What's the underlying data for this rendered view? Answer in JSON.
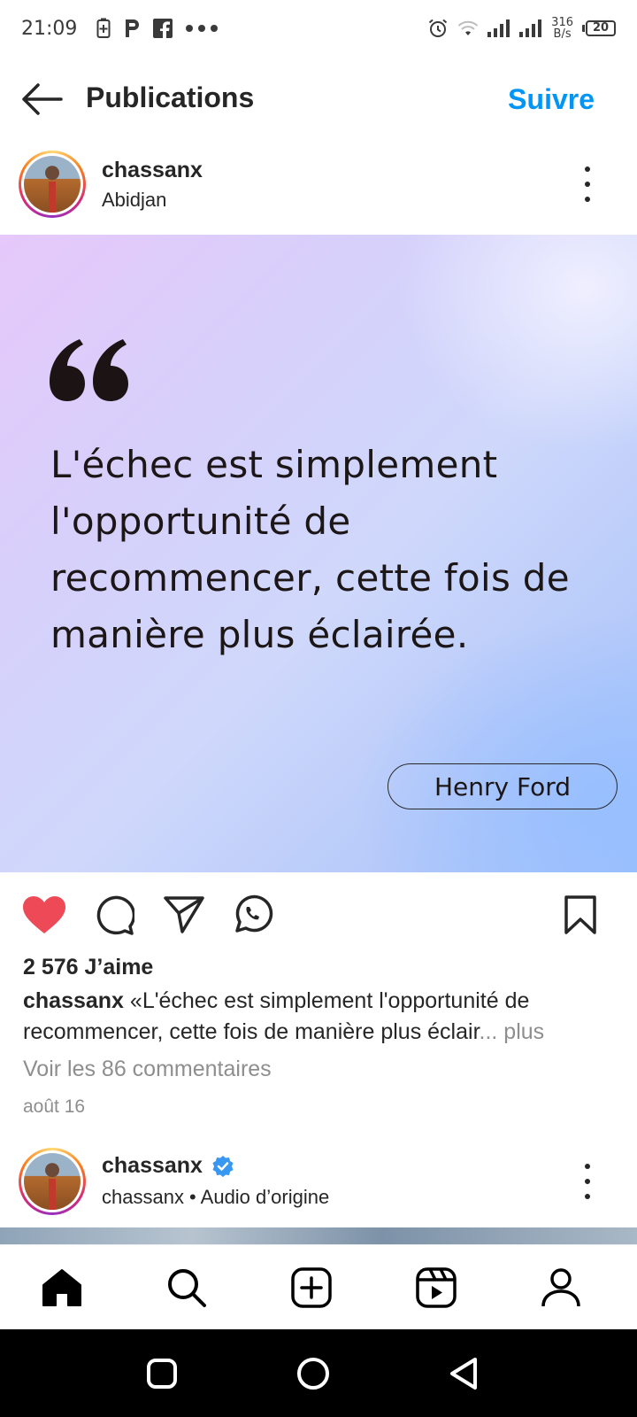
{
  "status_bar": {
    "time": "21:09",
    "left_icons": [
      "battery-saver-icon",
      "p-app-icon",
      "facebook-icon",
      "more-notifications-icon"
    ],
    "net_speed_value": "316",
    "net_speed_unit": "B/s",
    "battery_level": "20"
  },
  "header": {
    "title": "Publications",
    "follow_label": "Suivre",
    "accent_color": "#0095f6"
  },
  "post": {
    "username": "chassanx",
    "location": "Abidjan",
    "image": {
      "quote_text": "L'échec est simplement l'opportunité de recommencer, cette fois de manière plus éclairée.",
      "author": "Henry Ford"
    },
    "liked": true,
    "like_color": "#ed4956",
    "likes_text": "2 576 J’aime",
    "caption_user": "chassanx",
    "caption_text": "«L'échec est simplement l'opportunité de recommencer, cette fois de manière plus éclair",
    "caption_more": "... plus",
    "comments_link": "Voir les 86 commentaires",
    "date": "août 16"
  },
  "post2": {
    "username": "chassanx",
    "verified": true,
    "subtitle": "chassanx • Audio d’origine"
  },
  "bottom_nav": [
    "home-icon",
    "search-icon",
    "create-post-icon",
    "reels-icon",
    "profile-icon"
  ],
  "android_nav": [
    "recents-button",
    "home-button",
    "back-button"
  ]
}
